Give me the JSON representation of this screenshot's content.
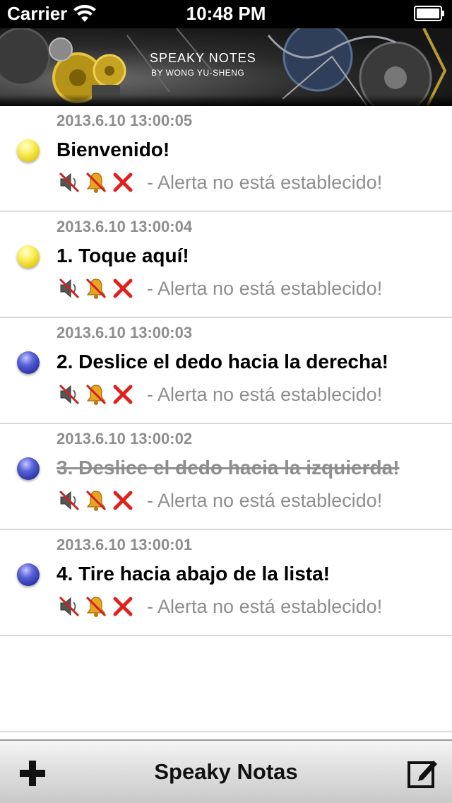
{
  "status_bar": {
    "carrier": "Carrier",
    "time": "10:48 PM",
    "wifi_icon": "wifi-icon",
    "battery_icon": "battery-icon"
  },
  "banner": {
    "title": "SPEAKY NOTES",
    "subtitle": "BY WONG YU-SHENG"
  },
  "notes": [
    {
      "timestamp": "2013.6.10 13:00:05",
      "title": "Bienvenido!",
      "status": "- Alerta no está establecido!",
      "dot_color": "yellow",
      "done": false
    },
    {
      "timestamp": "2013.6.10 13:00:04",
      "title": "1. Toque aquí!",
      "status": "- Alerta no está establecido!",
      "dot_color": "yellow",
      "done": false
    },
    {
      "timestamp": "2013.6.10 13:00:03",
      "title": "2. Deslice el dedo hacia la derecha!",
      "status": "- Alerta no está establecido!",
      "dot_color": "blue",
      "done": false
    },
    {
      "timestamp": "2013.6.10 13:00:02",
      "title": "3. Deslice el dedo hacia la izquierda!",
      "status": "- Alerta no está establecido!",
      "dot_color": "blue",
      "done": true
    },
    {
      "timestamp": "2013.6.10 13:00:01",
      "title": "4. Tire hacia abajo de la lista!",
      "status": "- Alerta no está establecido!",
      "dot_color": "blue",
      "done": false
    }
  ],
  "note_icons": [
    "speaker-muted-icon",
    "bell-muted-icon",
    "red-x-icon"
  ],
  "toolbar": {
    "title": "Speaky Notas",
    "add_icon": "plus-icon",
    "edit_icon": "compose-icon"
  },
  "colors": {
    "dot_yellow": "#f2e03a",
    "dot_blue": "#3a43b8",
    "status_gray": "#8e8e8e",
    "red_x": "#e0201c"
  }
}
